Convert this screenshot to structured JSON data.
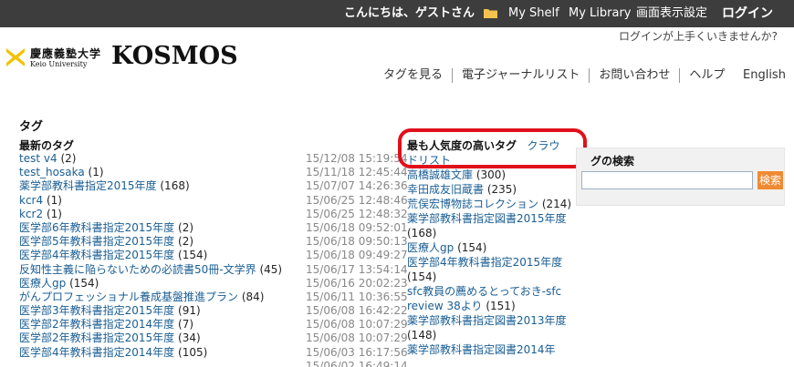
{
  "header": {
    "greeting": "こんにちは、ゲストさん",
    "my_shelf": "My Shelf",
    "my_library": "My Library",
    "display_settings": "画面表示設定",
    "login": "ログイン",
    "login_help": "ログインが上手くいきませんか?"
  },
  "logo": {
    "univ_jp": "慶應義塾大学",
    "univ_en": "Keio University",
    "name": "KOSMOS"
  },
  "nav": {
    "items": [
      "タグを見る",
      "電子ジャーナルリスト",
      "お問い合わせ",
      "ヘルプ"
    ],
    "english": "English"
  },
  "page": {
    "title": "タグ",
    "latest_heading": "最新のタグ",
    "popular_heading": "最も人気度の高いタグ",
    "cloud_link_1": "クラウ",
    "cloud_link_2": "ドリスト",
    "search_heading": "グの検索",
    "search_button": "検索",
    "search_value": ""
  },
  "latest_tags": [
    {
      "name": "test v4",
      "count": "(2)",
      "date": "15/12/08 15:19:54"
    },
    {
      "name": "test_hosaka",
      "count": "(1)",
      "date": "15/11/18 12:45:44"
    },
    {
      "name": "薬学部教科書指定2015年度",
      "count": "(168)",
      "date": "15/07/07 14:26:36"
    },
    {
      "name": "kcr4",
      "count": "(1)",
      "date": "15/06/25 12:48:46"
    },
    {
      "name": "kcr2",
      "count": "(1)",
      "date": "15/06/25 12:48:32"
    },
    {
      "name": "医学部6年教科書指定2015年度",
      "count": "(2)",
      "date": "15/06/18 09:52:01"
    },
    {
      "name": "医学部5年教科書指定2015年度",
      "count": "(2)",
      "date": "15/06/18 09:50:13"
    },
    {
      "name": "医学部4年教科書指定2015年度",
      "count": "(154)",
      "date": "15/06/18 09:49:27"
    },
    {
      "name": "反知性主義に陥らないための必読書50冊-文学界",
      "count": "(45)",
      "date": "15/06/17 13:54:14"
    },
    {
      "name": "医療人gp",
      "count": "(154)",
      "date": "15/06/16 20:02:23"
    },
    {
      "name": "がんプロフェッショナル養成基盤推進プラン",
      "count": "(84)",
      "date": "15/06/11 10:36:55"
    },
    {
      "name": "医学部3年教科書指定2015年度",
      "count": "(91)",
      "date": "15/06/08 16:42:22"
    },
    {
      "name": "医学部2年教科書指定2014年度",
      "count": "(7)",
      "date": "15/06/08 10:07:29"
    },
    {
      "name": "医学部2年教科書指定2015年度",
      "count": "(34)",
      "date": "15/06/08 10:07:29"
    },
    {
      "name": "医学部4年教科書指定2014年度",
      "count": "(105)",
      "date": "15/06/03 16:17:56"
    },
    {
      "name": "",
      "count": "",
      "date": "15/06/02 16:49:14"
    }
  ],
  "popular_tags": [
    {
      "name": "高橋誠雄文庫",
      "count": "(300)"
    },
    {
      "name": "幸田成友旧蔵書",
      "count": "(235)"
    },
    {
      "name": "荒俣宏博物誌コレクション",
      "count": "(214)"
    },
    {
      "name": "薬学部教科書指定図書2015年度",
      "count": "(168)"
    },
    {
      "name": "医療人gp",
      "count": "(154)"
    },
    {
      "name": "医学部4年教科書指定2015年度",
      "count": "(154)"
    },
    {
      "name": "sfc教員の薦めるとっておき-sfc review 38より",
      "count": "(151)"
    },
    {
      "name": "薬学部教科書指定図書2013年度",
      "count": "(148)"
    },
    {
      "name": "薬学部教科書指定図書2014年",
      "count": ""
    }
  ],
  "colors": {
    "topbar": "#3d3d3d",
    "link": "#1a5e94",
    "highlight": "#e0101a",
    "search_button": "#f08a32",
    "logo_yellow": "#f2c200"
  }
}
